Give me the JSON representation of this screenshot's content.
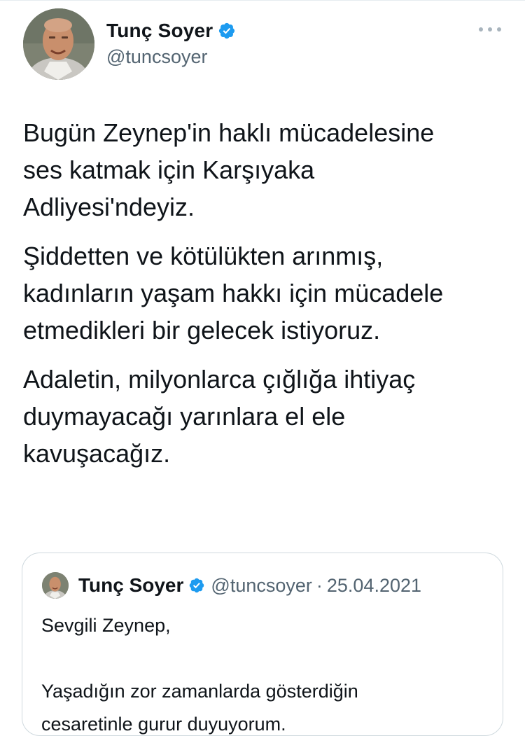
{
  "tweet": {
    "author_name": "Tunç Soyer",
    "author_handle": "@tuncsoyer",
    "paragraphs": [
      "Bugün Zeynep'in haklı mücadelesine\nses katmak için Karşıyaka\nAdliyesi'ndeyiz.",
      "Şiddetten ve kötülükten arınmış,\nkadınların yaşam hakkı için mücadele\netmedikleri bir gelecek istiyoruz.",
      "Adaletin, milyonlarca çığlığa ihtiyaç\nduymayacağı yarınlara el ele\nkavuşacağız."
    ]
  },
  "quoted_tweet": {
    "author_name": "Tunç Soyer",
    "author_handle": "@tuncsoyer",
    "separator": "·",
    "date": "25.04.2021",
    "text": "Sevgili Zeynep,\n\nYaşadığın zor zamanlarda gösterdiğin\ncesaretinle gurur duyuyorum."
  },
  "icons": {
    "verified": "verified-badge-icon",
    "more": "more-options-icon"
  },
  "colors": {
    "verified_blue": "#1d9bf0",
    "secondary_text": "#536471",
    "border": "#cfd9de"
  }
}
